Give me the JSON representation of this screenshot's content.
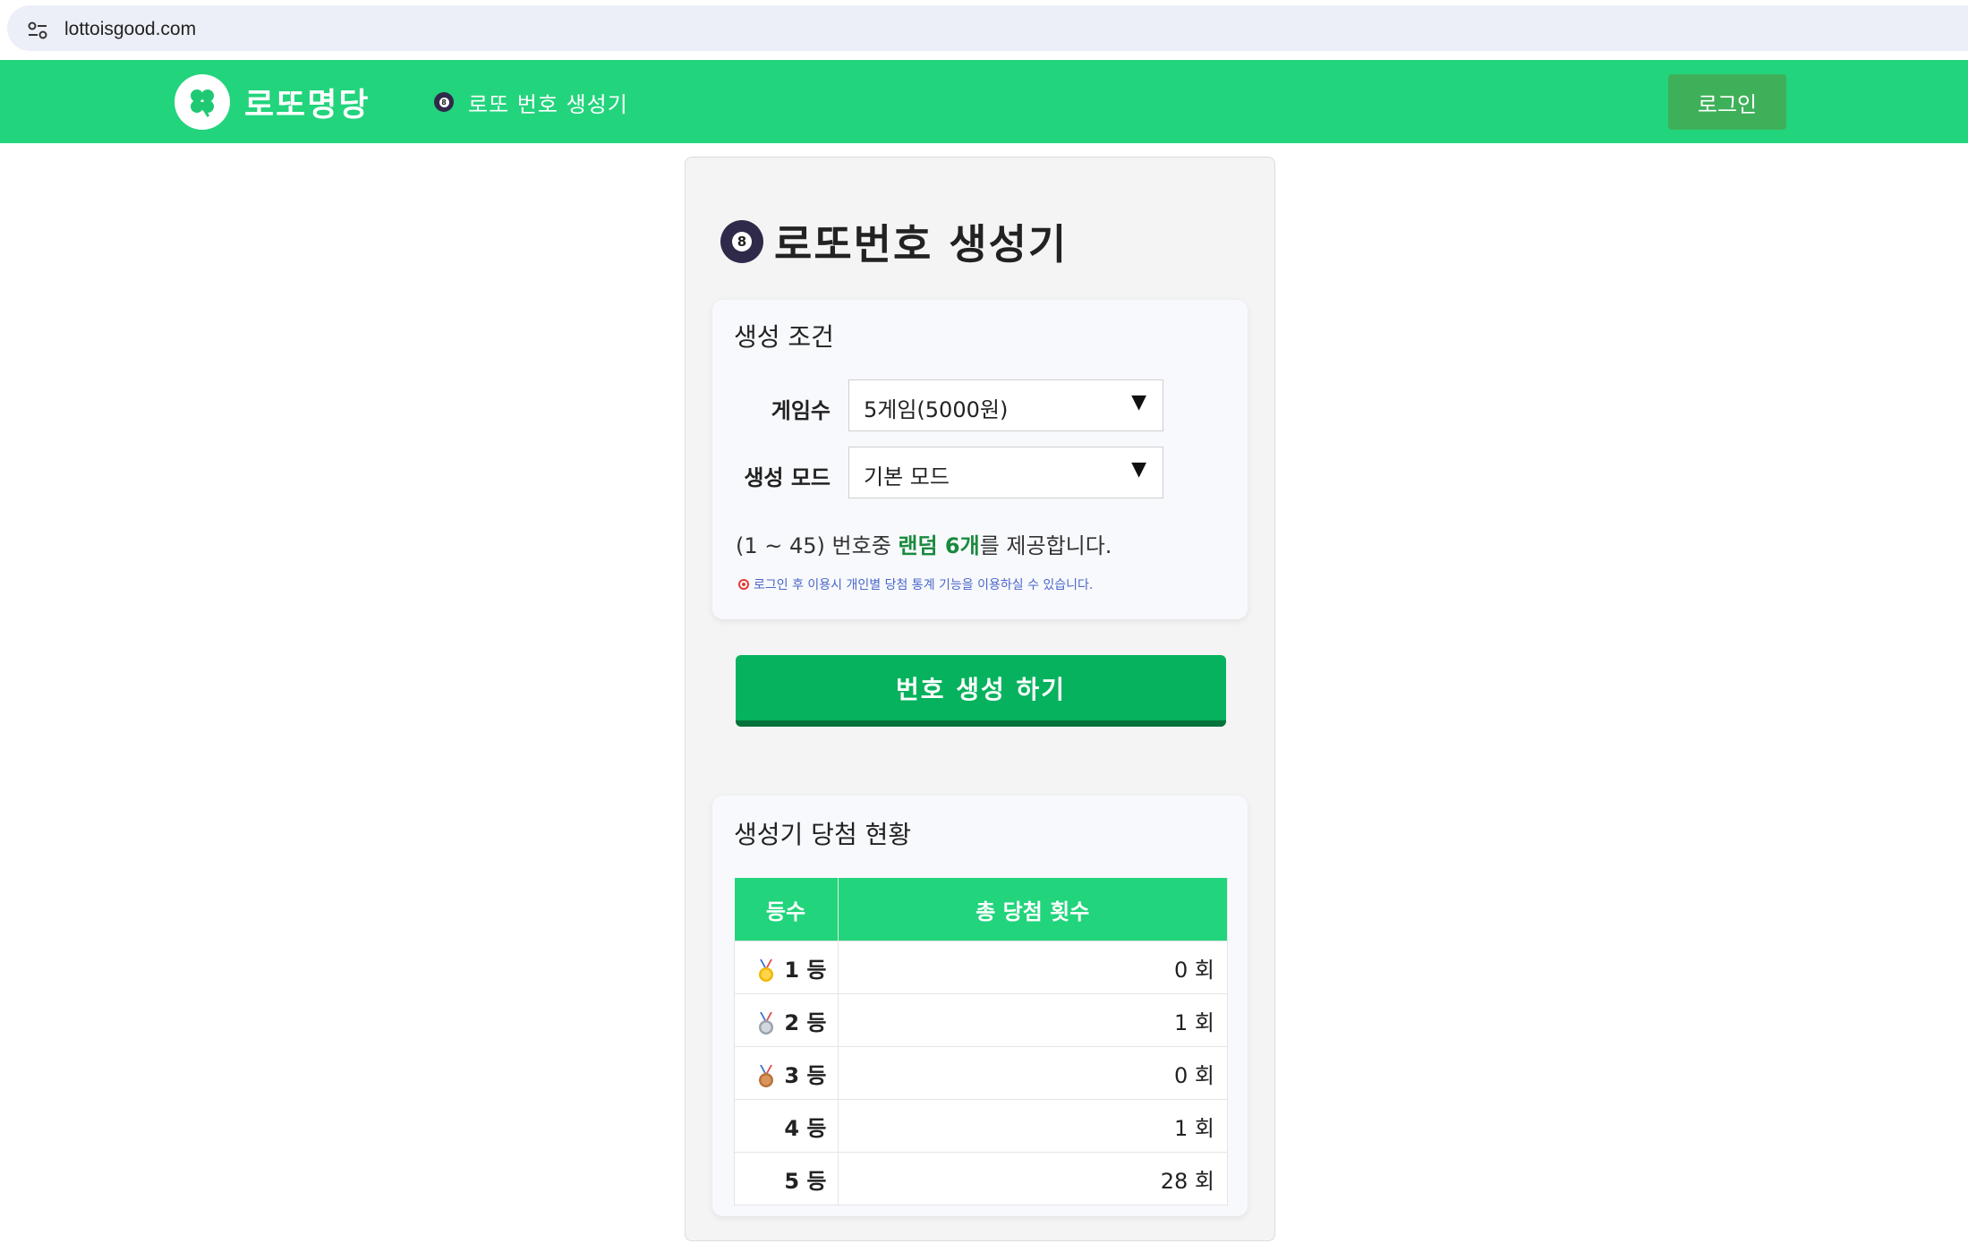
{
  "browser": {
    "url": "lottoisgood.com",
    "site_info_icon": "tune-icon"
  },
  "header": {
    "logo_icon": "four-leaf-clover-icon",
    "logo_text": "로또명당",
    "nav_icon": "eight-ball-icon",
    "nav_ball_number": "8",
    "nav_label": "로또 번호 생성기",
    "login_label": "로그인",
    "brand_color": "#22d47c"
  },
  "main": {
    "title_icon": "eight-ball-icon",
    "title_ball_number": "8",
    "title": "로또번호 생성기",
    "options": {
      "heading": "생성 조건",
      "games_label": "게임수",
      "games_value": "5게임(5000원)",
      "mode_label": "생성 모드",
      "mode_value": "기본 모드",
      "arrow": "▼",
      "desc_prefix": "(1 ~ 45) 번호중 ",
      "desc_highlight": "랜덤 6개",
      "desc_suffix": "를 제공합니다.",
      "notice": "로그인 후 이용시 개인별 당첨 통계 기능을 이용하실 수 있습니다.",
      "notice_icon": "target-icon"
    },
    "generate_label": "번호 생성 하기",
    "stats": {
      "heading": "생성기 당첨 현황",
      "col_rank": "등수",
      "col_count": "총 당첨 횟수",
      "rows": [
        {
          "rank": "1 등",
          "count": "0 회",
          "medal": "gold-medal-icon"
        },
        {
          "rank": "2 등",
          "count": "1 회",
          "medal": "silver-medal-icon"
        },
        {
          "rank": "3 등",
          "count": "0 회",
          "medal": "bronze-medal-icon"
        },
        {
          "rank": "4 등",
          "count": "1 회",
          "medal": ""
        },
        {
          "rank": "5 등",
          "count": "28 회",
          "medal": ""
        }
      ]
    }
  }
}
